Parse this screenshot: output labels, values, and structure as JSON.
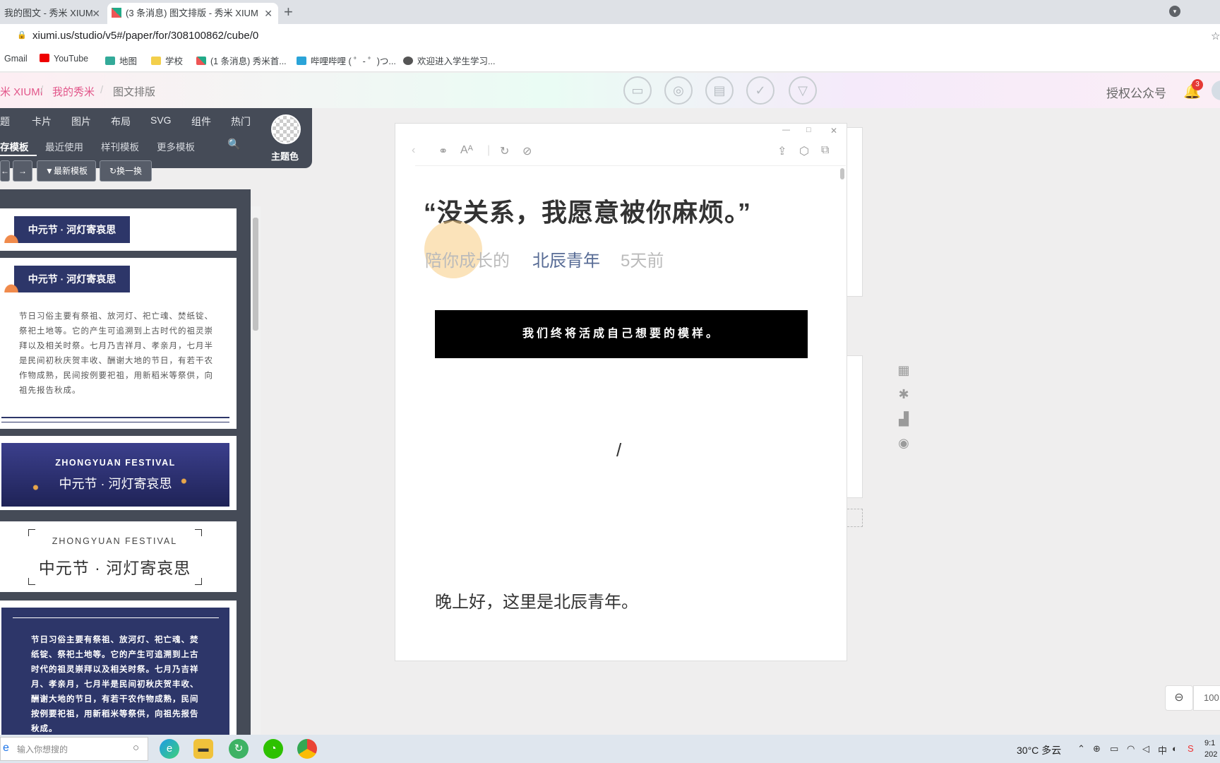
{
  "browser": {
    "tabs": [
      {
        "label": "我的图文 - 秀米 XIUM",
        "active": false
      },
      {
        "label": "(3 条消息) 图文排版 - 秀米 XIUM",
        "active": true
      }
    ],
    "url": "xiumi.us/studio/v5#/paper/for/308100862/cube/0",
    "bookmarks": [
      "Gmail",
      "YouTube",
      "地图",
      "学校",
      "(1 条消息) 秀米首...",
      "哔哩哔哩 ( ゜- ゜)つ...",
      "欢迎进入学生学习..."
    ]
  },
  "header": {
    "breadcrumb": [
      "米 XIUMI",
      "我的秀米",
      "图文排版"
    ],
    "authorize": "授权公众号",
    "notification_count": "3",
    "brand_color": "#e2568a"
  },
  "left_panel": {
    "categories": [
      "题",
      "卡片",
      "图片",
      "布局",
      "SVG",
      "组件",
      "热门"
    ],
    "subtabs": [
      "存模板",
      "最近使用",
      "样刊模板",
      "更多模板"
    ],
    "buttons": {
      "latest": "最新模板",
      "shuffle": "换一换"
    },
    "theme_label": "主题色",
    "templates": {
      "label1": "中元节 · 河灯寄哀思",
      "label2": "中元节 · 河灯寄哀思",
      "para1": "节日习俗主要有祭祖、放河灯、祀亡魂、焚纸锭、祭祀土地等。它的产生可追溯到上古时代的祖灵崇拜以及相关时祭。七月乃吉祥月、孝亲月，七月半是民间初秋庆贺丰收、酬谢大地的节日，有若干农作物成熟，民间按例要祀祖，用新稻米等祭供，向祖先报告秋成。",
      "banner_en": "ZHONGYUAN FESTIVAL",
      "banner_cn": "中元节 · 河灯寄哀思",
      "banner2_en": "ZHONGYUAN FESTIVAL",
      "banner2_cn": "中元节 · 河灯寄哀思",
      "para2": "节日习俗主要有祭祖、放河灯、祀亡魂、焚纸锭、祭祀土地等。它的产生可追溯到上古时代的祖灵崇拜以及相关时祭。七月乃吉祥月、孝亲月，七月半是民间初秋庆贺丰收、酬谢大地的节日，有若干农作物成熟，民间按例要祀祖，用新稻米等祭供，向祖先报告秋成。"
    }
  },
  "editor": {
    "title": "“没关系，我愿意被你麻烦。”",
    "meta": {
      "prefix": "陪你成长的",
      "author": "北辰青年",
      "time": "5天前"
    },
    "banner": "我们终将活成自己想要的模样。",
    "slash": "/",
    "greeting": "晚上好，这里是北辰青年。"
  },
  "zoom": "100",
  "taskbar": {
    "search_placeholder": "输入你想搜的",
    "weather": "30°C  多云",
    "clock_time": "9:1",
    "clock_date": "202"
  }
}
